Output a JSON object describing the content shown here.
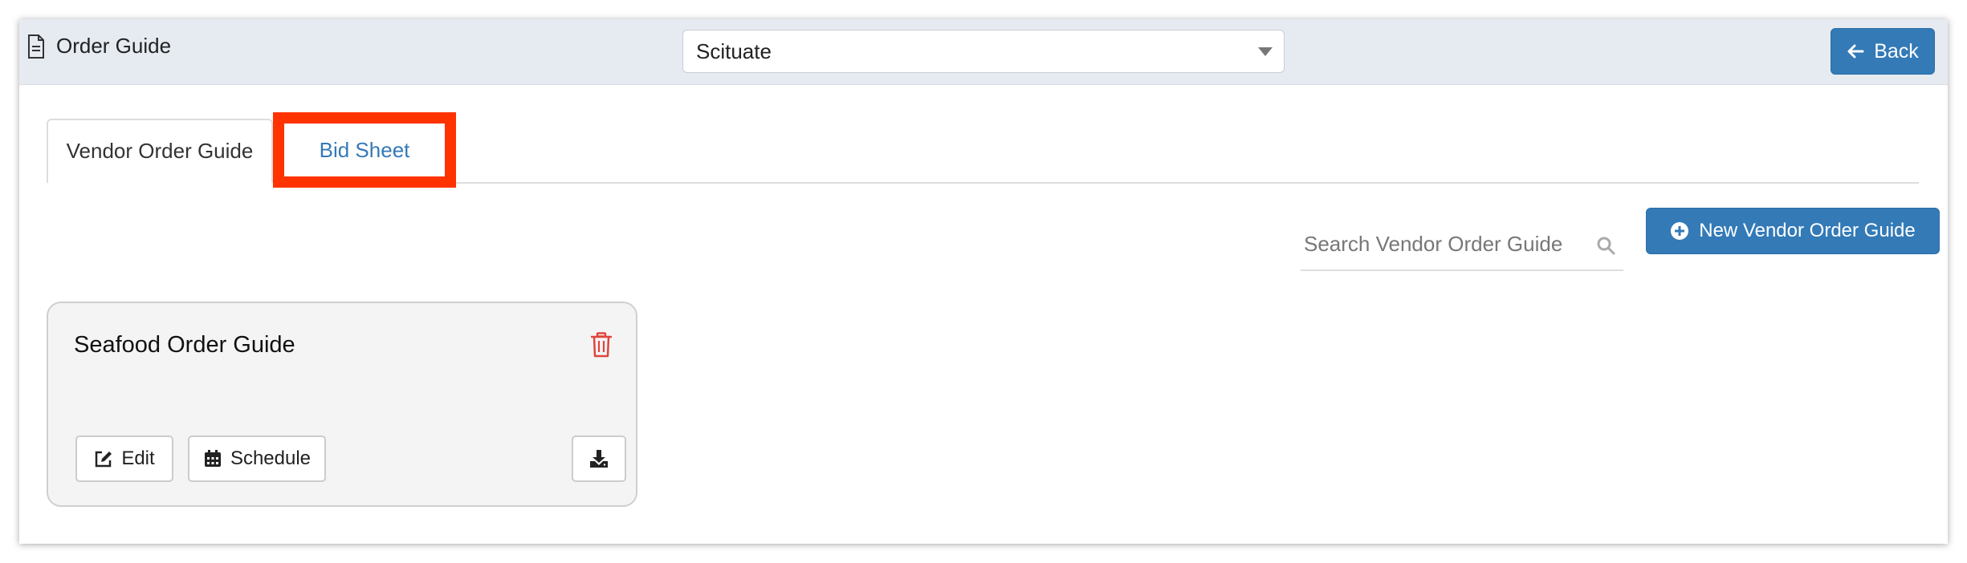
{
  "header": {
    "title": "Order Guide",
    "location_selected": "Scituate",
    "back_label": "Back"
  },
  "tabs": [
    {
      "label": "Vendor Order Guide",
      "active": true
    },
    {
      "label": "Bid Sheet",
      "active": false,
      "highlighted": true
    }
  ],
  "toolbar": {
    "search_placeholder": "Search Vendor Order Guide",
    "new_button_label": "New Vendor Order Guide"
  },
  "guides": [
    {
      "title": "Seafood Order Guide",
      "edit_label": "Edit",
      "schedule_label": "Schedule"
    }
  ],
  "colors": {
    "primary": "#337ab7",
    "header_bg": "#e6ebf2",
    "highlight": "#ff3300",
    "delete": "#e0443b"
  },
  "icons": [
    "document-icon",
    "chevron-down-icon",
    "arrow-left-icon",
    "search-icon",
    "plus-circle-icon",
    "trash-icon",
    "edit-icon",
    "calendar-icon",
    "download-icon"
  ]
}
